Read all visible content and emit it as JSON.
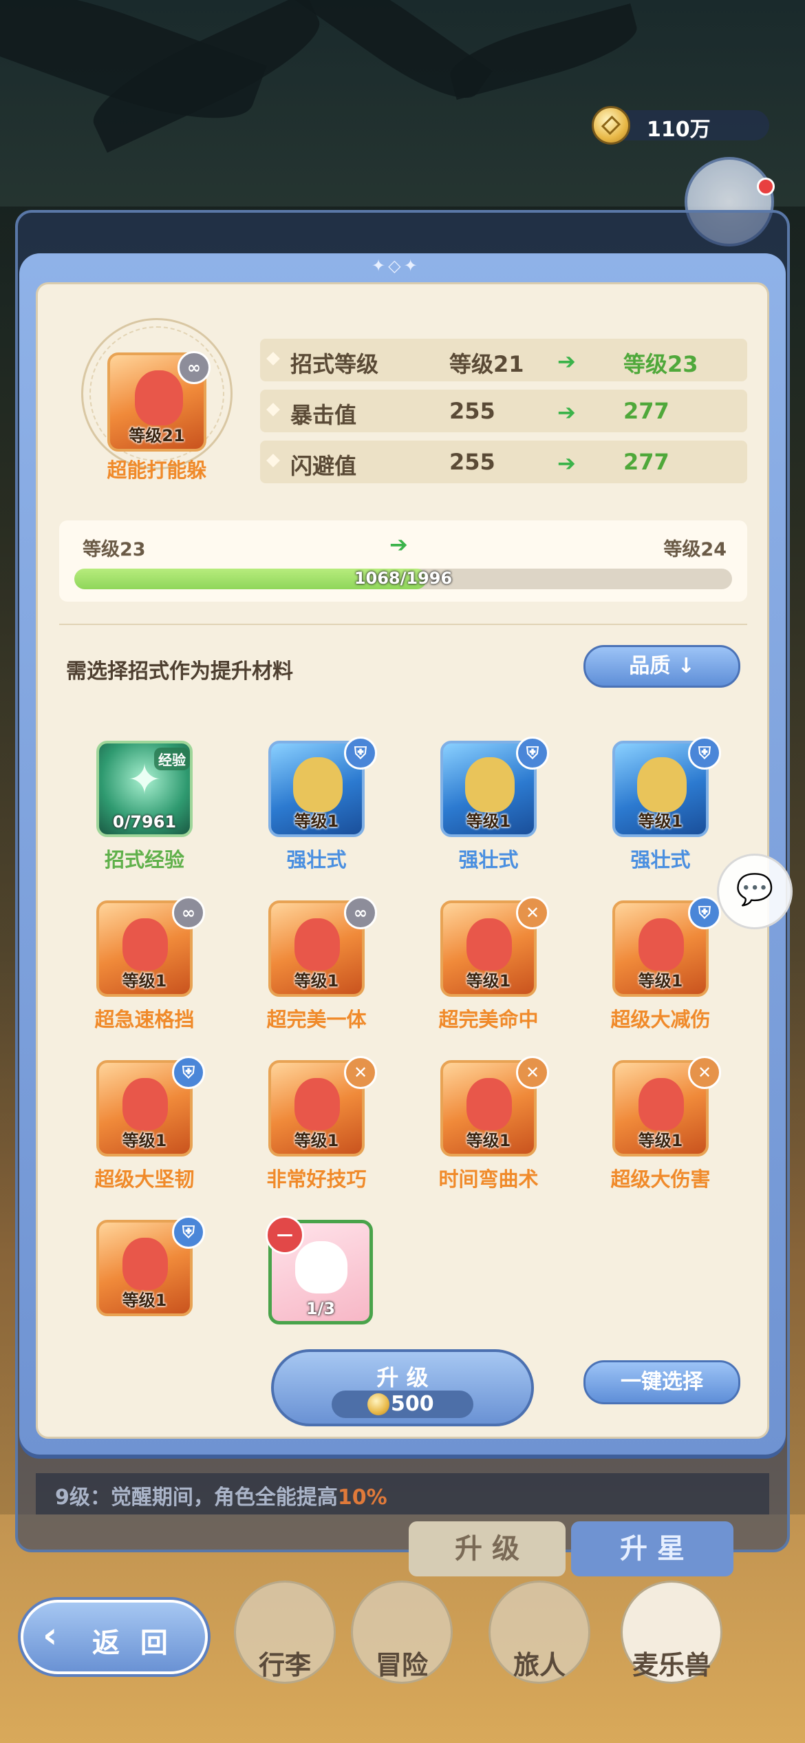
{
  "currency": {
    "amount": "110万",
    "icon": "gold-coin-icon"
  },
  "upgrade_panel": {
    "skill": {
      "name": "超能打能躲",
      "level": "等级21"
    },
    "stats": [
      {
        "label": "招式等级",
        "current": "等级21",
        "next": "等级23"
      },
      {
        "label": "暴击值",
        "current": "255",
        "next": "277"
      },
      {
        "label": "闪避值",
        "current": "255",
        "next": "277"
      }
    ],
    "progress": {
      "from_level": "等级23",
      "to_level": "等级24",
      "text": "1068/1996",
      "value": 1068,
      "max": 1996
    },
    "materials_title": "需选择招式作为提升材料",
    "quality_button": "品质",
    "materials": [
      {
        "name": "招式经验",
        "label": "0/7961",
        "tile": "green",
        "badge": "经验",
        "name_color": "green"
      },
      {
        "name": "强壮式",
        "label": "等级1",
        "tile": "blue",
        "badge": "shield",
        "name_color": "blue"
      },
      {
        "name": "强壮式",
        "label": "等级1",
        "tile": "blue",
        "badge": "shield",
        "name_color": "blue"
      },
      {
        "name": "强壮式",
        "label": "等级1",
        "tile": "blue",
        "badge": "shield",
        "name_color": "blue"
      },
      {
        "name": "超急速格挡",
        "label": "等级1",
        "tile": "orange",
        "badge": "link",
        "name_color": "orange"
      },
      {
        "name": "超完美一体",
        "label": "等级1",
        "tile": "orange",
        "badge": "link",
        "name_color": "orange"
      },
      {
        "name": "超完美命中",
        "label": "等级1",
        "tile": "orange",
        "badge": "sword",
        "name_color": "orange"
      },
      {
        "name": "超级大减伤",
        "label": "等级1",
        "tile": "orange",
        "badge": "shield",
        "name_color": "orange"
      },
      {
        "name": "超级大坚韧",
        "label": "等级1",
        "tile": "orange",
        "badge": "shield",
        "name_color": "orange"
      },
      {
        "name": "非常好技巧",
        "label": "等级1",
        "tile": "orange",
        "badge": "sword",
        "name_color": "orange"
      },
      {
        "name": "时间弯曲术",
        "label": "等级1",
        "tile": "orange",
        "badge": "sword",
        "name_color": "orange"
      },
      {
        "name": "超级大伤害",
        "label": "等级1",
        "tile": "orange",
        "badge": "sword",
        "name_color": "orange"
      },
      {
        "name": "",
        "label": "等级1",
        "tile": "orange",
        "badge": "shield",
        "name_color": "orange"
      },
      {
        "name": "",
        "label": "1/3",
        "tile": "pink",
        "badge": "remove",
        "name_color": "orange"
      }
    ],
    "upgrade_button": {
      "label": "升 级",
      "cost": "500"
    },
    "one_key_button": "一键选择"
  },
  "background": {
    "hint_prefix": "9级：觉醒期间，角色全能提高",
    "hint_value": "10%",
    "tab_upgrade": "升 级",
    "tab_star": "升 星"
  },
  "bottom_nav": {
    "back": "返 回",
    "items": [
      "行李",
      "冒险",
      "旅人",
      "麦乐兽"
    ]
  },
  "colors": {
    "accent_blue": "#6f93d2",
    "green_progress": "#8fd65a",
    "orange_text": "#f08a2a"
  }
}
